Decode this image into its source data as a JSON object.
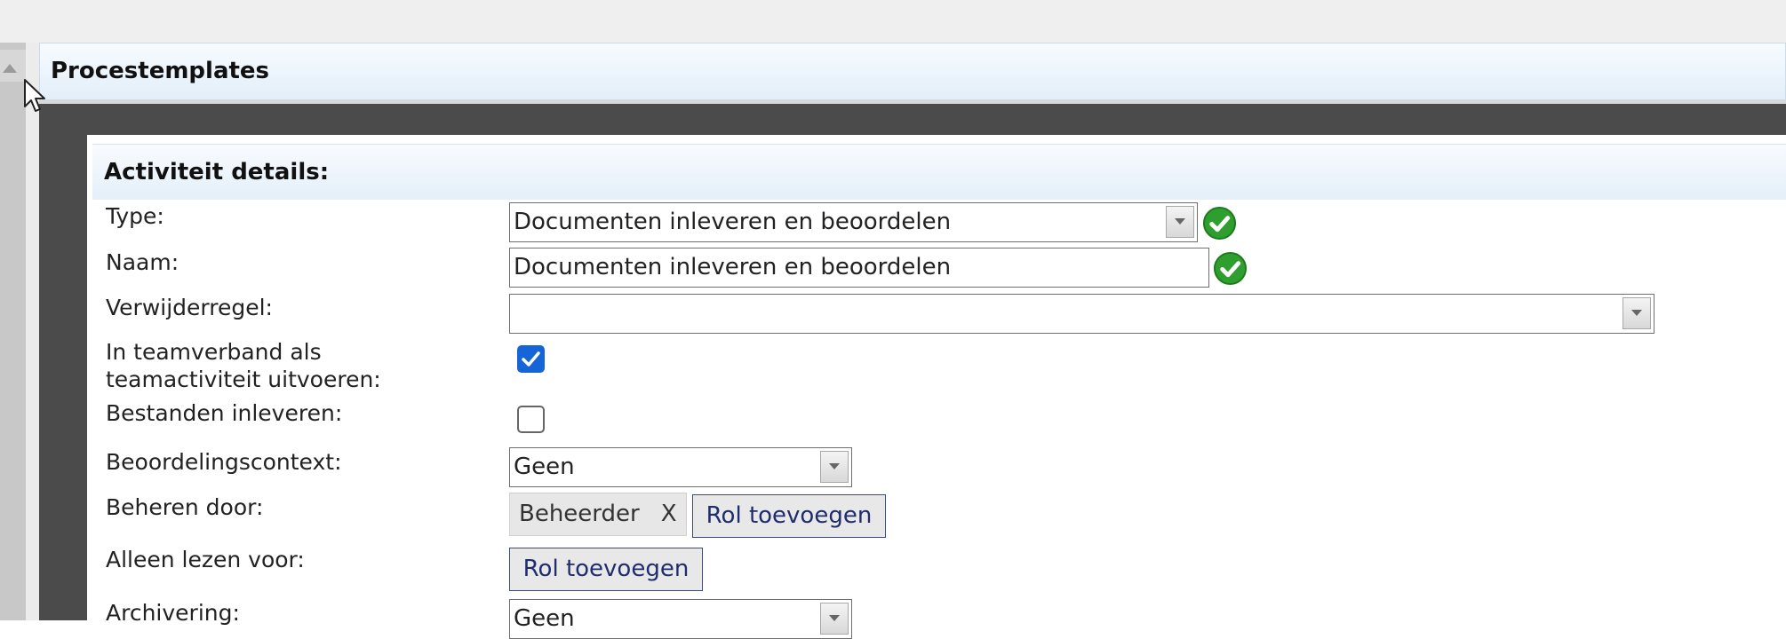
{
  "panel": {
    "title": "Procestemplates"
  },
  "section": {
    "title": "Activiteit details:"
  },
  "fields": {
    "type": {
      "label": "Type:",
      "value": "Documenten inleveren en beoordelen"
    },
    "naam": {
      "label": "Naam:",
      "value": "Documenten inleveren en beoordelen"
    },
    "verwijderregel": {
      "label": "Verwijderregel:",
      "value": ""
    },
    "teamverband": {
      "label_line1": "In teamverband als",
      "label_line2": "teamactiviteit uitvoeren:",
      "checked": true
    },
    "bestanden": {
      "label": "Bestanden inleveren:",
      "checked": false
    },
    "beoordelingscontext": {
      "label": "Beoordelingscontext:",
      "value": "Geen"
    },
    "beheren_door": {
      "label": "Beheren door:",
      "tag": "Beheerder",
      "tag_remove": "X",
      "add_button": "Rol toevoegen"
    },
    "alleen_lezen": {
      "label": "Alleen lezen voor:",
      "add_button": "Rol toevoegen"
    },
    "archivering": {
      "label": "Archivering:",
      "value": "Geen"
    }
  },
  "colors": {
    "header_gradient": "#e2eef9",
    "frame": "#4b4b4b",
    "check_blue": "#1565d8",
    "ok_green": "#2e9e2e",
    "button_text": "#1f2d6e"
  }
}
